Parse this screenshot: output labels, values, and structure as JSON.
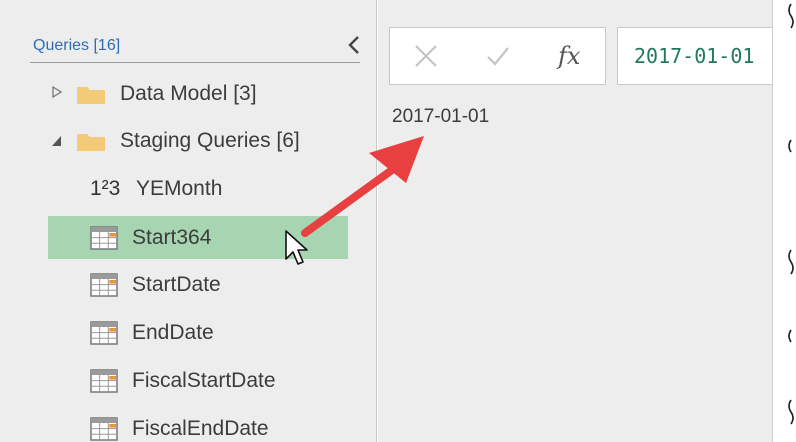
{
  "queries_pane": {
    "header": "Queries [16]",
    "items": [
      {
        "label": "Data Model [3]",
        "icon": "folder-icon",
        "expander": "collapsed"
      },
      {
        "label": "Staging Queries [6]",
        "icon": "folder-icon",
        "expander": "expanded"
      },
      {
        "label": "YEMonth",
        "icon": "number-type-icon",
        "icon_text": "1²3"
      },
      {
        "label": "Start364",
        "icon": "table-icon",
        "selected": true
      },
      {
        "label": "StartDate",
        "icon": "table-icon"
      },
      {
        "label": "EndDate",
        "icon": "table-icon"
      },
      {
        "label": "FiscalStartDate",
        "icon": "table-icon"
      },
      {
        "label": "FiscalEndDate",
        "icon": "table-icon"
      }
    ]
  },
  "formula_bar": {
    "cancel_icon": "close-icon",
    "commit_icon": "checkmark-icon",
    "fx_label": "fx",
    "formula": "2017-01-01"
  },
  "preview": {
    "value": "2017-01-01"
  },
  "colors": {
    "selected_row": "#a8d5b1",
    "header_text": "#2f6db3",
    "formula_text": "#1f7a5a",
    "annotation_arrow": "#e84040"
  }
}
